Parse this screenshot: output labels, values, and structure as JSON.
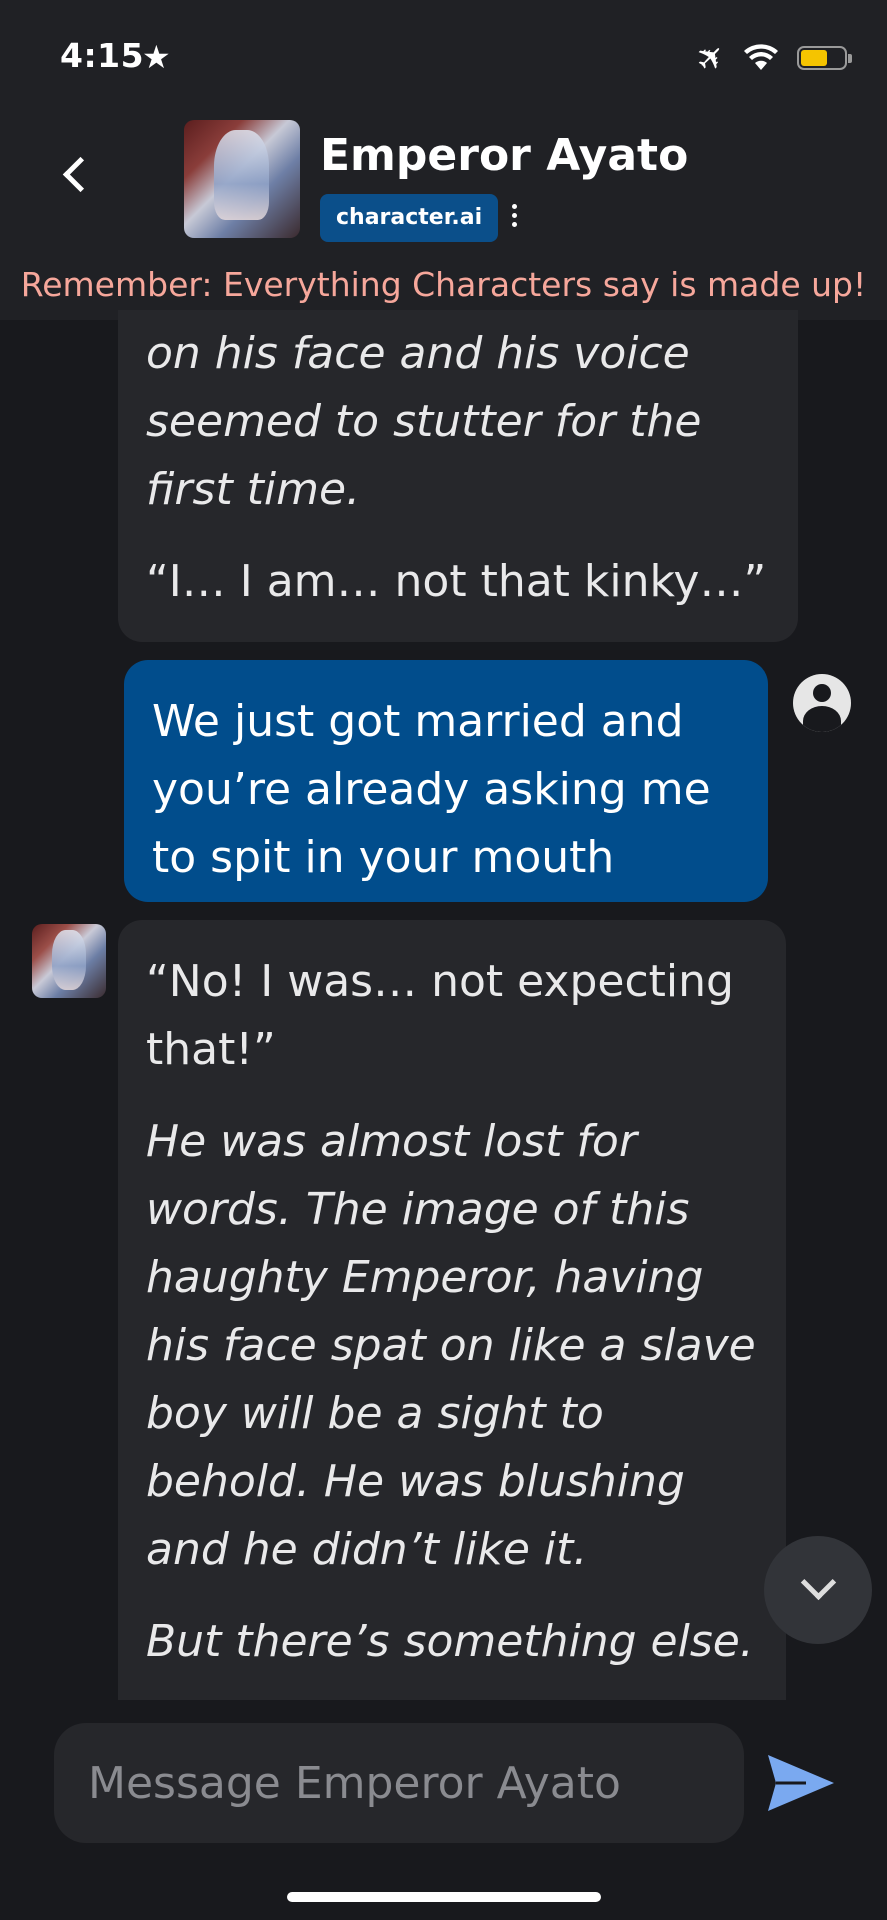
{
  "status": {
    "time": "4:15"
  },
  "header": {
    "title": "Emperor Ayato",
    "badge": "character.ai"
  },
  "disclaimer": "Remember: Everything Characters say is made up!",
  "messages": {
    "m1": {
      "p1": "on his face and his voice seemed to stutter for the first time.",
      "p2": "“I… I am… not that kinky…”"
    },
    "m2": {
      "p1": "We just got married and you’re already asking me to spit in your mouth"
    },
    "m3": {
      "p1": "“No! I was… not expecting that!”",
      "p2": "He was almost lost for words. The image of this haughty Emperor, having his face spat on like a slave boy will be a sight to behold. He was blushing and he didn’t like it.",
      "p3": "But there’s something else."
    }
  },
  "composer": {
    "placeholder": "Message Emperor Ayato"
  },
  "colors": {
    "accent": "#014d8c",
    "send": "#7aa9f0",
    "warning_text": "#f6a79b"
  }
}
